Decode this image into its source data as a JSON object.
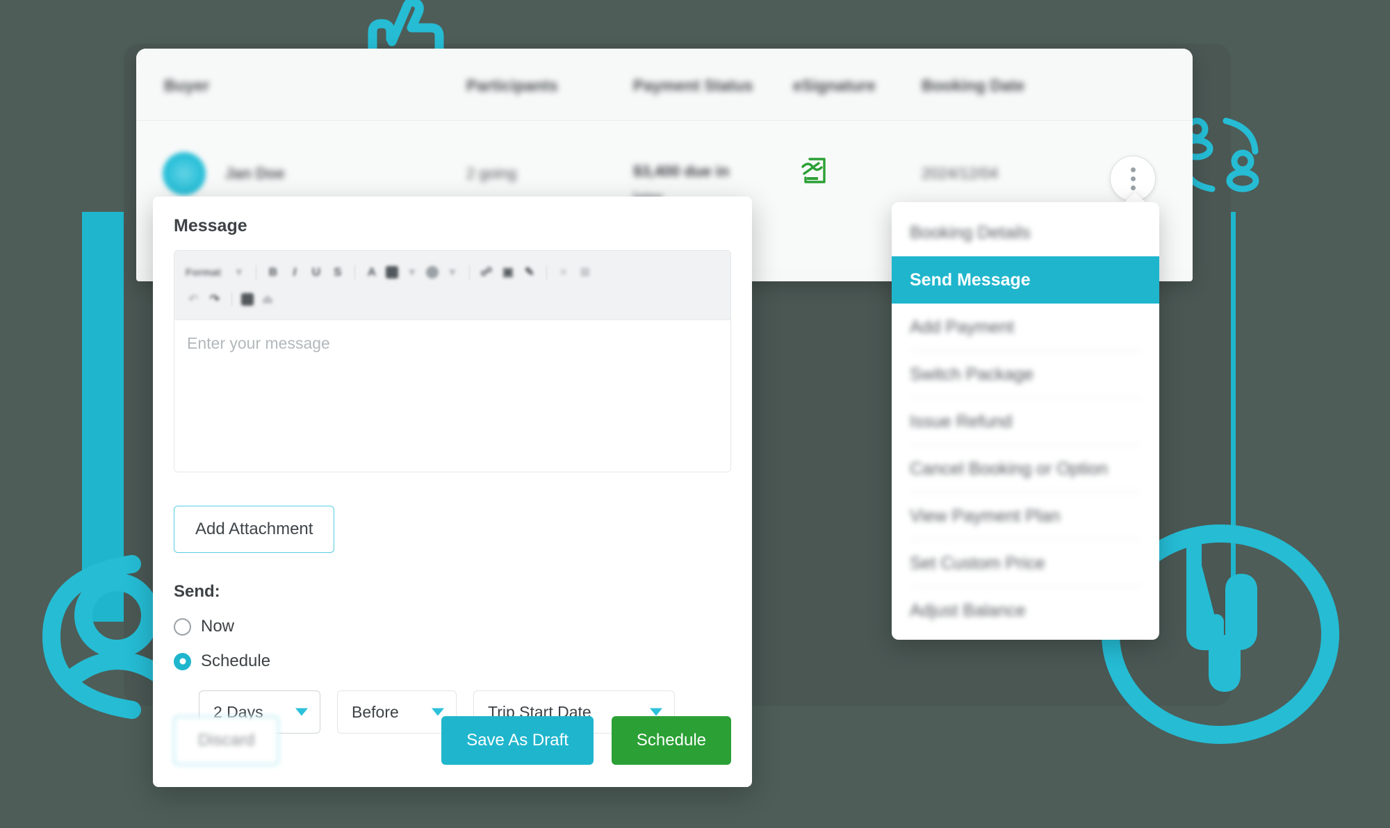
{
  "colors": {
    "background": "#4e5d58",
    "accent_teal": "#1fb6cd",
    "accent_green": "#2ba035",
    "dark_card": "#4a5753",
    "esign_green": "#2ba035"
  },
  "table": {
    "columns": [
      "Buyer",
      "Participants",
      "Payment Status",
      "eSignature",
      "Booking Date"
    ],
    "row": {
      "buyer": "Jan Doe",
      "participants": "2 going",
      "payment_status_amount": "$3,400 due in",
      "payment_status_when": "later",
      "esignature_icon": "signature-pen-document-icon",
      "booking_date": "2024/12/04"
    },
    "kebab_icon": "more-vertical-icon"
  },
  "context_menu": {
    "items": [
      {
        "label": "Booking Details",
        "active": false,
        "divider": false
      },
      {
        "label": "Send Message",
        "active": true,
        "divider": false
      },
      {
        "label": "Add Payment",
        "active": false,
        "divider": true
      },
      {
        "label": "Switch Package",
        "active": false,
        "divider": true
      },
      {
        "label": "Issue Refund",
        "active": false,
        "divider": true
      },
      {
        "label": "Cancel Booking or Option",
        "active": false,
        "divider": true
      },
      {
        "label": "View Payment Plan",
        "active": false,
        "divider": true
      },
      {
        "label": "Set Custom Price",
        "active": false,
        "divider": true
      },
      {
        "label": "Adjust Balance",
        "active": false,
        "divider": false
      }
    ]
  },
  "composer": {
    "title": "Message",
    "toolbar": {
      "format_label": "Format",
      "row1": [
        {
          "name": "format-dropdown-caret-icon",
          "glyph": "▾"
        },
        {
          "name": "bold-icon",
          "glyph": "B"
        },
        {
          "name": "italic-icon",
          "glyph": "I"
        },
        {
          "name": "underline-icon",
          "glyph": "U"
        },
        {
          "name": "strikethrough-icon",
          "glyph": "S"
        },
        {
          "name": "text-color-icon",
          "glyph": "A"
        },
        {
          "name": "highlight-color-icon",
          "glyph": ""
        },
        {
          "name": "emoji-icon",
          "glyph": ""
        },
        {
          "name": "link-icon",
          "glyph": "☍"
        },
        {
          "name": "image-icon",
          "glyph": "▣"
        },
        {
          "name": "attachment-icon",
          "glyph": "✒"
        },
        {
          "name": "align-left-icon",
          "glyph": "≡"
        },
        {
          "name": "table-icon",
          "glyph": "⊞"
        }
      ],
      "row2": [
        {
          "name": "undo-icon",
          "glyph": "↶"
        },
        {
          "name": "redo-icon",
          "glyph": "↷"
        },
        {
          "name": "code-block-icon",
          "glyph": "■"
        },
        {
          "name": "clear-format-icon",
          "glyph": "⌧"
        }
      ]
    },
    "message_placeholder": "Enter your message",
    "message_value": "",
    "add_attachment_label": "Add Attachment",
    "send_label": "Send:",
    "send_options": [
      {
        "label": "Now",
        "selected": false
      },
      {
        "label": "Schedule",
        "selected": true
      }
    ],
    "schedule": {
      "amount": "2 Days",
      "relation": "Before",
      "anchor": "Trip Start Date"
    },
    "buttons": {
      "discard": "Discard",
      "save_draft": "Save As Draft",
      "schedule": "Schedule"
    }
  },
  "doodles": [
    {
      "name": "thumbs-up-doodle"
    },
    {
      "name": "people-users-doodle"
    },
    {
      "name": "user-avatar-doodle"
    },
    {
      "name": "pointing-hand-circle-doodle"
    }
  ]
}
